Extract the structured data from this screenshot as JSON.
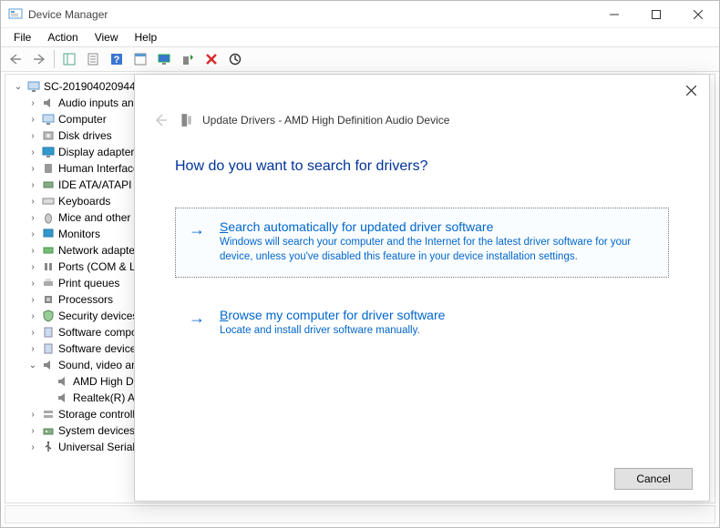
{
  "window": {
    "title": "Device Manager"
  },
  "menubar": {
    "file": "File",
    "action": "Action",
    "view": "View",
    "help": "Help"
  },
  "tree": {
    "root": "SC-201904020944",
    "nodes": [
      "Audio inputs and outputs",
      "Computer",
      "Disk drives",
      "Display adapters",
      "Human Interface Devices",
      "IDE ATA/ATAPI controllers",
      "Keyboards",
      "Mice and other pointing devices",
      "Monitors",
      "Network adapters",
      "Ports (COM & LPT)",
      "Print queues",
      "Processors",
      "Security devices",
      "Software components",
      "Software devices"
    ],
    "sound_node": "Sound, video and game controllers",
    "sound_children": [
      "AMD High Definition Audio Device",
      "Realtek(R) Audio"
    ],
    "tail_nodes": [
      "Storage controllers",
      "System devices",
      "Universal Serial Bus controllers"
    ]
  },
  "dialog": {
    "title": "Update Drivers - AMD High Definition Audio Device",
    "question": "How do you want to search for drivers?",
    "option1": {
      "title_pre": "S",
      "title_rest": "earch automatically for updated driver software",
      "desc": "Windows will search your computer and the Internet for the latest driver software for your device, unless you've disabled this feature in your device installation settings."
    },
    "option2": {
      "title_pre": "B",
      "title_rest": "rowse my computer for driver software",
      "desc": "Locate and install driver software manually."
    },
    "cancel": "Cancel"
  }
}
